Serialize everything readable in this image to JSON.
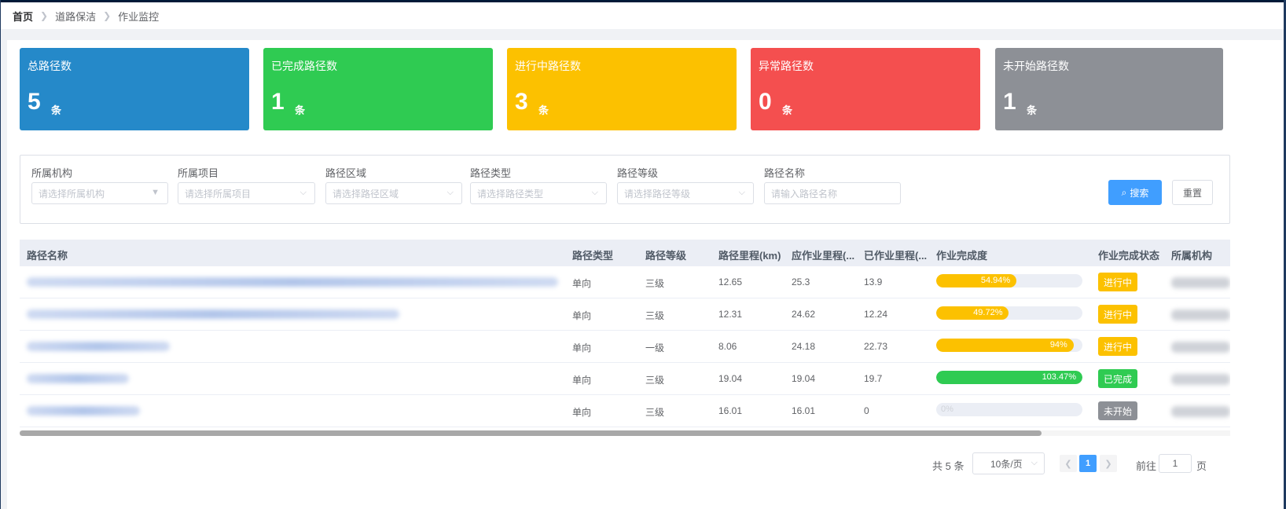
{
  "breadcrumb": [
    "首页",
    "道路保洁",
    "作业监控"
  ],
  "stats": [
    {
      "title": "总路径数",
      "value": "5",
      "unit": "条",
      "color": "#2589c9"
    },
    {
      "title": "已完成路径数",
      "value": "1",
      "unit": "条",
      "color": "#2fcb52"
    },
    {
      "title": "进行中路径数",
      "value": "3",
      "unit": "条",
      "color": "#fcc100"
    },
    {
      "title": "异常路径数",
      "value": "0",
      "unit": "条",
      "color": "#f44f4f"
    },
    {
      "title": "未开始路径数",
      "value": "1",
      "unit": "条",
      "color": "#8d9096"
    }
  ],
  "filters": {
    "org": {
      "label": "所属机构",
      "placeholder": "请选择所属机构"
    },
    "project": {
      "label": "所属项目",
      "placeholder": "请选择所属项目"
    },
    "area": {
      "label": "路径区域",
      "placeholder": "请选择路径区域"
    },
    "type": {
      "label": "路径类型",
      "placeholder": "请选择路径类型"
    },
    "level": {
      "label": "路径等级",
      "placeholder": "请选择路径等级"
    },
    "name": {
      "label": "路径名称",
      "placeholder": "请输入路径名称"
    },
    "search_label": "搜索",
    "reset_label": "重置"
  },
  "table": {
    "headers": [
      "路径名称",
      "路径类型",
      "路径等级",
      "路径里程(km)",
      "应作业里程(...",
      "已作业里程(...",
      "作业完成度",
      "作业完成状态",
      "所属机构"
    ],
    "rows": [
      {
        "type": "单向",
        "level": "三级",
        "mileage": "12.65",
        "planned": "25.3",
        "done": "13.9",
        "progress": 54.94,
        "progress_text": "54.94%",
        "status": "进行中",
        "status_color": "#fcc100"
      },
      {
        "type": "单向",
        "level": "三级",
        "mileage": "12.31",
        "planned": "24.62",
        "done": "12.24",
        "progress": 49.72,
        "progress_text": "49.72%",
        "status": "进行中",
        "status_color": "#fcc100"
      },
      {
        "type": "单向",
        "level": "一级",
        "mileage": "8.06",
        "planned": "24.18",
        "done": "22.73",
        "progress": 94,
        "progress_text": "94%",
        "status": "进行中",
        "status_color": "#fcc100"
      },
      {
        "type": "单向",
        "level": "三级",
        "mileage": "19.04",
        "planned": "19.04",
        "done": "19.7",
        "progress": 100,
        "progress_text": "103.47%",
        "status": "已完成",
        "status_color": "#2fcb52"
      },
      {
        "type": "单向",
        "level": "三级",
        "mileage": "16.01",
        "planned": "16.01",
        "done": "0",
        "progress": 0,
        "progress_text": "0%",
        "status": "未开始",
        "status_color": "#8d9096"
      }
    ]
  },
  "pagination": {
    "total": "共 5 条",
    "page_size": "10条/页",
    "current": "1",
    "goto_label": "前往",
    "goto_value": "1",
    "page_suffix": "页"
  }
}
